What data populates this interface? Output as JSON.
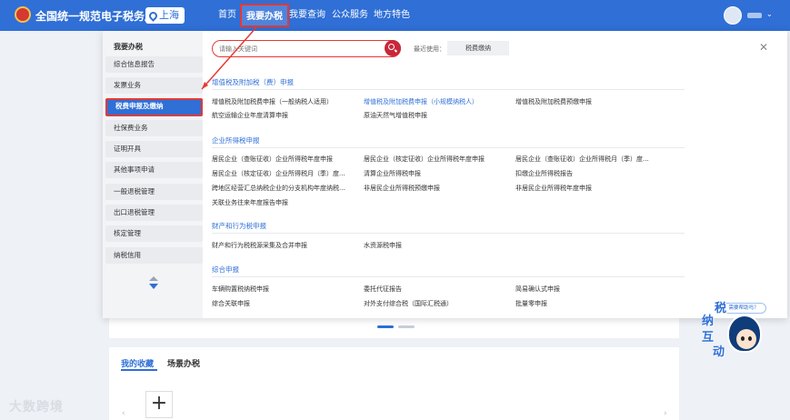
{
  "header": {
    "site_title": "全国统一规范电子税务局",
    "region": "上海",
    "nav": [
      "首页",
      "我要办税",
      "我要查询",
      "公众服务",
      "地方特色"
    ]
  },
  "menu": {
    "side_title": "我要办税",
    "side_items": [
      "综合信息报告",
      "发票业务",
      "税费申报及缴纳",
      "社保费业务",
      "证明开具",
      "其他事项申请",
      "一般退税管理",
      "出口退税管理",
      "核定管理",
      "纳税信用"
    ],
    "search_placeholder": "请输入关键词",
    "recent_label": "最近使用：",
    "recent_tag": "税费缴纳",
    "sections": [
      {
        "title": "增值税及附加税（费）申报",
        "links": [
          [
            "增值税及附加税费申报（一般纳税人适用）",
            "增值税及附加税费申报（小规模纳税人）",
            "增值税及附加税费预缴申报"
          ],
          [
            "航空运输企业年度清算申报",
            "原油天然气增值税申报",
            ""
          ]
        ]
      },
      {
        "title": "企业所得税申报",
        "links": [
          [
            "居民企业（查账征收）企业所得税年度申报",
            "居民企业（核定征收）企业所得税年度申报",
            "居民企业（查账征收）企业所得税月（季）度..."
          ],
          [
            "居民企业（核定征收）企业所得税月（季）度...",
            "清算企业所得税申报",
            "扣缴企业所得税报告"
          ],
          [
            "跨地区经营汇总纳税企业的分支机构年度纳税...",
            "非居民企业所得税预缴申报",
            "非居民企业所得税年度申报"
          ],
          [
            "关联业务往来年度报告申报",
            "",
            ""
          ]
        ]
      },
      {
        "title": "财产和行为税申报",
        "links": [
          [
            "财产和行为税税源采集及合并申报",
            "水资源税申报",
            ""
          ]
        ]
      },
      {
        "title": "综合申报",
        "links": [
          [
            "车辆购置税纳税申报",
            "委托代征报告",
            "简易确认式申报"
          ],
          [
            "综合关联申报",
            "对外支付综合税（国际汇税通）",
            "批量零申报"
          ]
        ]
      }
    ]
  },
  "favorites": {
    "tabs": [
      "我的收藏",
      "场景办税"
    ]
  },
  "watermark": "大数跨境",
  "assistant": {
    "bubble": "需要帮助吗？",
    "chars": [
      "纳",
      "互",
      "动",
      "税"
    ]
  },
  "colors": {
    "brand": "#2f6fd6",
    "highlight": "#e53935"
  }
}
